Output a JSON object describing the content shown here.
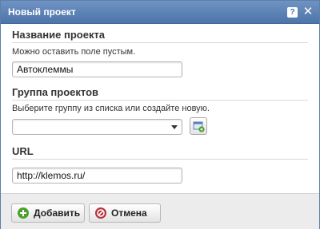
{
  "dialog": {
    "title": "Новый проект",
    "help_glyph": "?",
    "close_glyph": "✕"
  },
  "project_name": {
    "heading": "Название проекта",
    "hint": "Можно оставить поле пустым.",
    "value": "Автоклеммы"
  },
  "project_group": {
    "heading": "Группа проектов",
    "hint": "Выберите группу из списка или создайте новую.",
    "selected": ""
  },
  "url": {
    "heading": "URL",
    "value": "http://klemos.ru/"
  },
  "buttons": {
    "add_label": "Добавить",
    "cancel_label": "Отмена"
  },
  "colors": {
    "titlebar": "#4d74a9",
    "add_icon": "#4aa12f",
    "cancel_icon": "#b4323c"
  },
  "icons": {
    "help": "help-icon",
    "close": "close-icon",
    "add": "plus-circle-icon",
    "cancel": "cancel-circle-icon",
    "new_group": "new-group-icon"
  }
}
